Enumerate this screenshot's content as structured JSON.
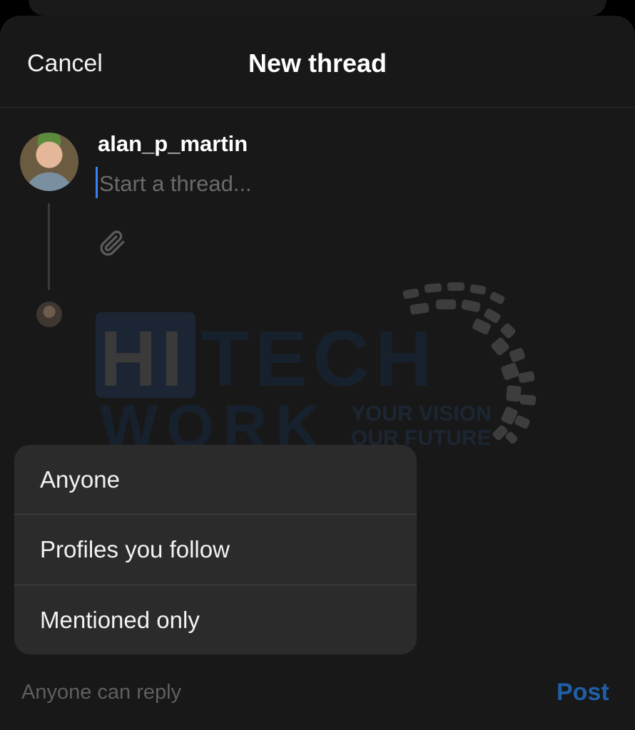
{
  "header": {
    "cancel_label": "Cancel",
    "title": "New thread"
  },
  "composer": {
    "username": "alan_p_martin",
    "placeholder": "Start a thread...",
    "value": ""
  },
  "watermark": {
    "word1": "HI",
    "word2": "TECH",
    "word3": "WORK",
    "tagline1": "YOUR VISION",
    "tagline2": "OUR FUTURE"
  },
  "reply_menu": {
    "options": [
      {
        "label": "Anyone"
      },
      {
        "label": "Profiles you follow"
      },
      {
        "label": "Mentioned only"
      }
    ]
  },
  "footer": {
    "reply_setting": "Anyone can reply",
    "post_label": "Post"
  },
  "colors": {
    "background": "#181818",
    "accent": "#3b82f6",
    "post_disabled": "#1f5fa8",
    "menu_bg": "#2b2b2b"
  }
}
